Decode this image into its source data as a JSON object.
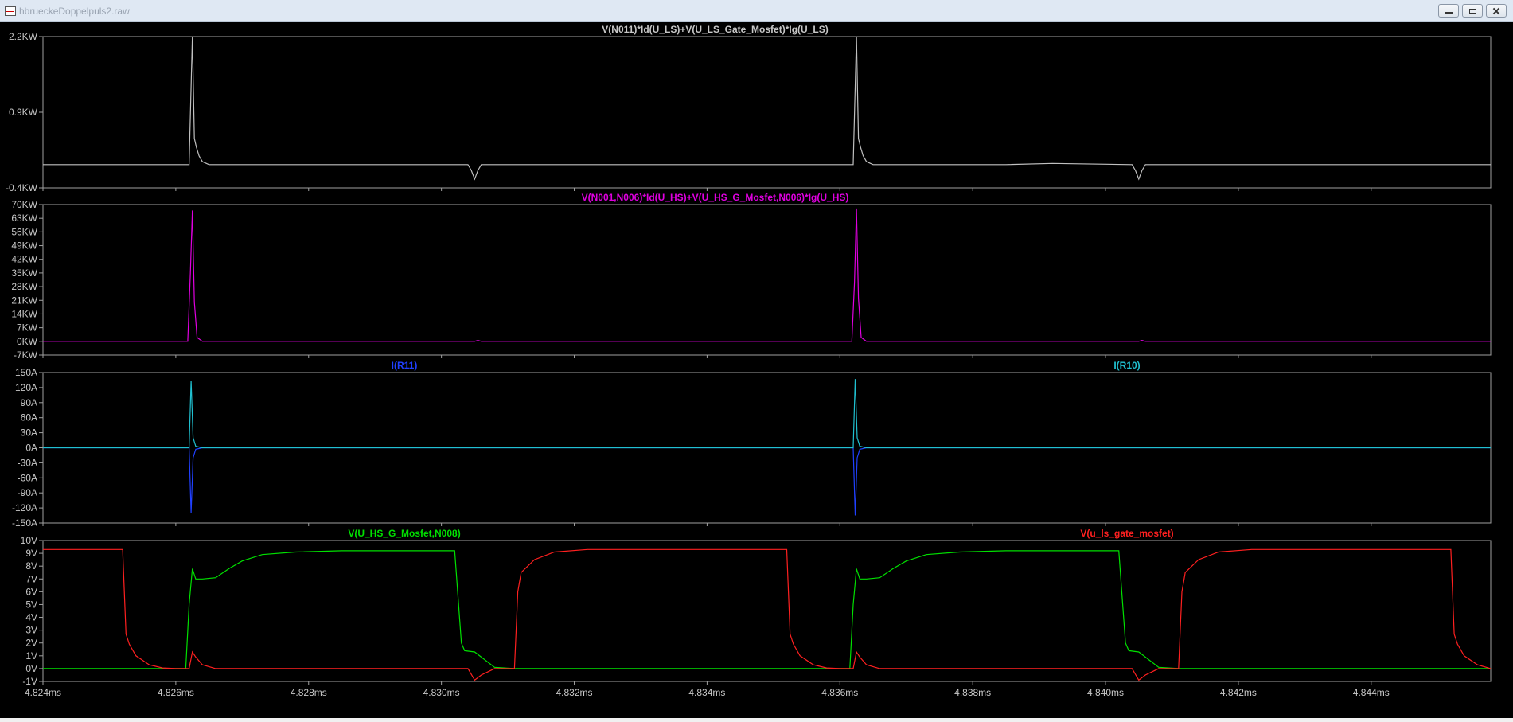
{
  "window": {
    "title": "hbrueckeDoppelpuls2.raw",
    "buttons": [
      "minimize",
      "maximize",
      "close"
    ]
  },
  "chart_data": [
    {
      "type": "line",
      "title": "V(N011)*Id(U_LS)+V(U_LS_Gate_Mosfet)*Ig(U_LS)",
      "title_color": "#c8c8c8",
      "ylim": [
        -0.4,
        2.2
      ],
      "yticks": [
        "2.2KW",
        "0.9KW",
        "-0.4KW"
      ],
      "ytick_values": [
        2.2,
        0.9,
        -0.4
      ],
      "series": [
        {
          "name": "V(N011)*Id(U_LS)+V(U_LS_Gate_Mosfet)*Ig(U_LS)",
          "color": "#c0c0c0",
          "x": [
            4.824,
            4.8262,
            4.82625,
            4.82628,
            4.82631,
            4.82635,
            4.8264,
            4.8265,
            4.8268,
            4.8304,
            4.83045,
            4.8305,
            4.83055,
            4.8306,
            4.8362,
            4.83625,
            4.83628,
            4.83631,
            4.83635,
            4.8364,
            4.8365,
            4.8368,
            4.8385,
            4.8392,
            4.8404,
            4.84045,
            4.8405,
            4.84055,
            4.8406,
            4.8458
          ],
          "y": [
            0.0,
            0.0,
            2.2,
            0.45,
            0.3,
            0.15,
            0.05,
            0.0,
            0.0,
            0.0,
            -0.1,
            -0.25,
            -0.1,
            0.0,
            0.0,
            2.2,
            0.45,
            0.3,
            0.15,
            0.05,
            0.0,
            0.0,
            0.0,
            0.02,
            0.0,
            -0.1,
            -0.25,
            -0.1,
            0.0,
            0.0
          ]
        }
      ]
    },
    {
      "type": "line",
      "title": "V(N001,N006)*Id(U_HS)+V(U_HS_G_Mosfet,N006)*Ig(U_HS)",
      "title_color": "#e000e0",
      "ylim": [
        -7,
        70
      ],
      "yticks": [
        "70KW",
        "63KW",
        "56KW",
        "49KW",
        "42KW",
        "35KW",
        "28KW",
        "21KW",
        "14KW",
        "7KW",
        "0KW",
        "-7KW"
      ],
      "ytick_values": [
        70,
        63,
        56,
        49,
        42,
        35,
        28,
        21,
        14,
        7,
        0,
        -7
      ],
      "series": [
        {
          "name": "V(N001,N006)*Id(U_HS)+V(U_HS_G_Mosfet,N006)*Ig(U_HS)",
          "color": "#e000e0",
          "x": [
            4.824,
            4.82618,
            4.82622,
            4.82625,
            4.82628,
            4.82632,
            4.8264,
            4.8305,
            4.83055,
            4.8306,
            4.83618,
            4.83622,
            4.83625,
            4.83628,
            4.83632,
            4.8364,
            4.8405,
            4.84055,
            4.8406,
            4.8458
          ],
          "y": [
            0,
            0,
            35,
            67,
            20,
            2,
            0,
            0,
            0.5,
            0,
            0,
            30,
            68,
            22,
            2,
            0,
            0,
            0.5,
            0,
            0
          ]
        }
      ]
    },
    {
      "type": "line",
      "title": "",
      "legend": [
        {
          "label": "I(R11)",
          "color": "#2040ff"
        },
        {
          "label": "I(R10)",
          "color": "#20c0d0"
        }
      ],
      "ylim": [
        -150,
        150
      ],
      "yticks": [
        "150A",
        "120A",
        "90A",
        "60A",
        "30A",
        "0A",
        "-30A",
        "-60A",
        "-90A",
        "-120A",
        "-150A"
      ],
      "ytick_values": [
        150,
        120,
        90,
        60,
        30,
        0,
        -30,
        -60,
        -90,
        -120,
        -150
      ],
      "series": [
        {
          "name": "I(R11)",
          "color": "#2040ff",
          "x": [
            4.824,
            4.8262,
            4.82623,
            4.82626,
            4.8263,
            4.8264,
            4.8362,
            4.83623,
            4.83626,
            4.8363,
            4.8364,
            4.8458
          ],
          "y": [
            0,
            0,
            -130,
            -20,
            -3,
            0,
            0,
            -135,
            -20,
            -3,
            0,
            0
          ]
        },
        {
          "name": "I(R10)",
          "color": "#20c0d0",
          "x": [
            4.824,
            4.8262,
            4.82623,
            4.82626,
            4.8263,
            4.8264,
            4.8362,
            4.83623,
            4.83626,
            4.8363,
            4.8364,
            4.8458
          ],
          "y": [
            0,
            0,
            133,
            20,
            3,
            0,
            0,
            137,
            20,
            3,
            0,
            0
          ]
        }
      ]
    },
    {
      "type": "line",
      "title": "",
      "legend": [
        {
          "label": "V(U_HS_G_Mosfet,N008)",
          "color": "#00e000"
        },
        {
          "label": "V(u_ls_gate_mosfet)",
          "color": "#ff2020"
        }
      ],
      "ylim": [
        -1,
        10
      ],
      "yticks": [
        "10V",
        "9V",
        "8V",
        "7V",
        "6V",
        "5V",
        "4V",
        "3V",
        "2V",
        "1V",
        "0V",
        "-1V"
      ],
      "ytick_values": [
        10,
        9,
        8,
        7,
        6,
        5,
        4,
        3,
        2,
        1,
        0,
        -1
      ],
      "series": [
        {
          "name": "V(U_HS_G_Mosfet,N008)",
          "color": "#00e000",
          "x": [
            4.824,
            4.82615,
            4.8262,
            4.82625,
            4.8263,
            4.8264,
            4.8266,
            4.8268,
            4.827,
            4.8273,
            4.8278,
            4.8285,
            4.8302,
            4.8303,
            4.83035,
            4.8305,
            4.8306,
            4.8308,
            4.8311,
            4.8315,
            4.8359,
            4.83615,
            4.8362,
            4.83625,
            4.8363,
            4.8364,
            4.8366,
            4.8368,
            4.837,
            4.8373,
            4.8378,
            4.8385,
            4.8402,
            4.8403,
            4.84035,
            4.8405,
            4.8406,
            4.8408,
            4.8411,
            4.8415,
            4.8458
          ],
          "y": [
            0,
            0,
            5.0,
            7.8,
            7.0,
            7.0,
            7.1,
            7.8,
            8.4,
            8.9,
            9.1,
            9.2,
            9.2,
            2.0,
            1.4,
            1.3,
            0.9,
            0.1,
            0,
            0,
            0,
            0,
            5.0,
            7.8,
            7.0,
            7.0,
            7.1,
            7.8,
            8.4,
            8.9,
            9.1,
            9.2,
            9.2,
            2.0,
            1.4,
            1.3,
            0.9,
            0.1,
            0,
            0,
            0
          ]
        },
        {
          "name": "V(u_ls_gate_mosfet)",
          "color": "#ff2020",
          "x": [
            4.824,
            4.8252,
            4.82525,
            4.8253,
            4.8254,
            4.8256,
            4.8258,
            4.826,
            4.8262,
            4.82625,
            4.8263,
            4.8264,
            4.8266,
            4.8304,
            4.8305,
            4.8306,
            4.8308,
            4.831,
            4.8311,
            4.83115,
            4.8312,
            4.8314,
            4.8317,
            4.8322,
            4.8352,
            4.83525,
            4.8353,
            4.8354,
            4.8356,
            4.8358,
            4.836,
            4.8362,
            4.83625,
            4.8363,
            4.8364,
            4.8366,
            4.8404,
            4.8405,
            4.8406,
            4.8408,
            4.841,
            4.8411,
            4.84115,
            4.8412,
            4.8414,
            4.8417,
            4.8422,
            4.8452,
            4.84525,
            4.8453,
            4.8454,
            4.8456,
            4.8458
          ],
          "y": [
            9.3,
            9.3,
            2.7,
            1.9,
            1.0,
            0.3,
            0.05,
            0,
            0,
            1.3,
            0.9,
            0.3,
            0,
            0,
            -0.9,
            -0.5,
            0,
            0,
            0,
            6.0,
            7.5,
            8.5,
            9.1,
            9.3,
            9.3,
            2.7,
            1.9,
            1.0,
            0.3,
            0.05,
            0,
            0,
            1.3,
            0.9,
            0.3,
            0,
            0,
            -0.9,
            -0.5,
            0,
            0,
            0,
            6.0,
            7.5,
            8.5,
            9.1,
            9.3,
            9.3,
            2.7,
            1.9,
            1.0,
            0.3,
            0
          ]
        }
      ]
    }
  ],
  "x_axis": {
    "xlim": [
      4.824,
      4.8458
    ],
    "ticks": [
      "4.824ms",
      "4.826ms",
      "4.828ms",
      "4.830ms",
      "4.832ms",
      "4.834ms",
      "4.836ms",
      "4.838ms",
      "4.840ms",
      "4.842ms",
      "4.844ms"
    ],
    "tick_values": [
      4.824,
      4.826,
      4.828,
      4.83,
      4.832,
      4.834,
      4.836,
      4.838,
      4.84,
      4.842,
      4.844
    ]
  },
  "colors": {
    "background": "#000000",
    "frame": "#a0a0a0",
    "axis_text": "#c8c8c8"
  }
}
